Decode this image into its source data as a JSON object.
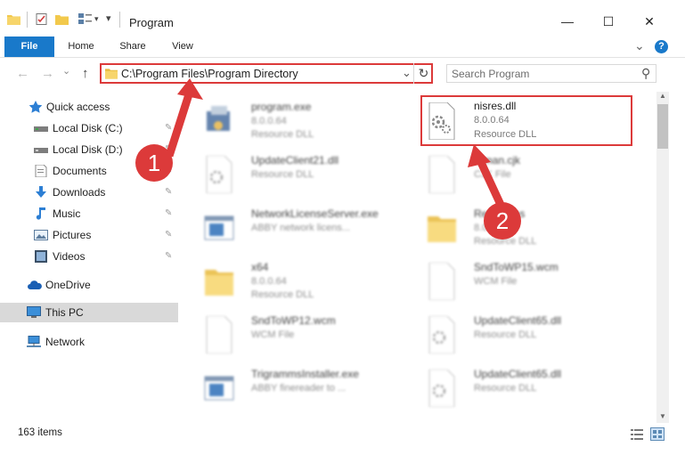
{
  "window": {
    "title": "Program",
    "minimize_glyph": "—",
    "maximize_glyph": "☐",
    "close_glyph": "✕"
  },
  "ribbon": {
    "tabs": [
      "File",
      "Home",
      "Share",
      "View"
    ],
    "expand_glyph": "⌄",
    "help_glyph": "?"
  },
  "nav": {
    "back_glyph": "←",
    "forward_glyph": "→",
    "recent_glyph": "⌄",
    "up_glyph": "↑",
    "address": "C:\\Program Files\\Program Directory",
    "address_dropdown_glyph": "⌄",
    "refresh_glyph": "↻",
    "search_placeholder": "Search Program",
    "search_glyph": "⚲"
  },
  "sidebar": {
    "items": [
      {
        "label": "Quick access",
        "icon": "star-icon"
      },
      {
        "label": "Local Disk (C:)",
        "icon": "drive-icon"
      },
      {
        "label": "Local Disk (D:)",
        "icon": "drive-icon"
      },
      {
        "label": "Documents",
        "icon": "documents-icon"
      },
      {
        "label": "Downloads",
        "icon": "downloads-icon"
      },
      {
        "label": "Music",
        "icon": "music-icon"
      },
      {
        "label": "Pictures",
        "icon": "pictures-icon"
      },
      {
        "label": "Videos",
        "icon": "videos-icon"
      },
      {
        "label": "OneDrive",
        "icon": "cloud-icon"
      },
      {
        "label": "This PC",
        "icon": "computer-icon"
      },
      {
        "label": "Network",
        "icon": "network-icon"
      }
    ],
    "pin_glyph": "✎"
  },
  "files": [
    {
      "name": "program.exe",
      "line1": "8.0.0.64",
      "line2": "Resource DLL",
      "icon": "exe-icon"
    },
    {
      "name": "nisres.dll",
      "line1": "8.0.0.64",
      "line2": "Resource DLL",
      "icon": "dll-gear-icon"
    },
    {
      "name": "UpdateClient21.dll",
      "line1": "Resource DLL",
      "line2": "",
      "icon": "dll-gear-icon"
    },
    {
      "name": "ruman.cjk",
      "line1": "CJK File",
      "line2": "",
      "icon": "generic-file-icon"
    },
    {
      "name": "NetworkLicenseServer.exe",
      "line1": "ABBY network licens...",
      "line2": "",
      "icon": "window-app-icon"
    },
    {
      "name": "Resources",
      "line1": "8.0.0.64",
      "line2": "Resource DLL",
      "icon": "folder-icon"
    },
    {
      "name": "x64",
      "line1": "8.0.0.64",
      "line2": "Resource DLL",
      "icon": "folder-icon"
    },
    {
      "name": "SndToWP15.wcm",
      "line1": "WCM File",
      "line2": "",
      "icon": "generic-file-icon"
    },
    {
      "name": "SndToWP12.wcm",
      "line1": "WCM File",
      "line2": "",
      "icon": "generic-file-icon"
    },
    {
      "name": "UpdateClient65.dll",
      "line1": "Resource DLL",
      "line2": "",
      "icon": "dll-gear-icon"
    },
    {
      "name": "TrigrammsInstaller.exe",
      "line1": "ABBY finereader to ...",
      "line2": "",
      "icon": "window-app-icon"
    },
    {
      "name": "UpdateClient65.dll",
      "line1": "Resource DLL",
      "line2": "",
      "icon": "dll-gear-icon"
    }
  ],
  "status": {
    "item_count": "163 items"
  },
  "callouts": [
    "1",
    "2"
  ],
  "colors": {
    "accent": "#1979ca",
    "highlight_red": "#dc3a3a",
    "folder_yellow": "#f2c94c"
  }
}
